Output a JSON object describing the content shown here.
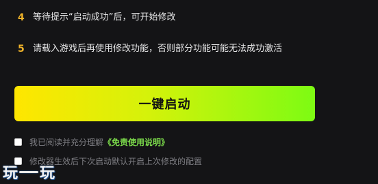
{
  "steps": [
    {
      "number": "4",
      "text": "等待提示“启动成功”后，可开始修改"
    },
    {
      "number": "5",
      "text": "请载入游戏后再使用修改功能，否则部分功能可能无法成功激活"
    }
  ],
  "launch_button": {
    "label": "一键启动"
  },
  "checkboxes": [
    {
      "text": "我已阅读并充分理解",
      "link": "《免责使用说明》"
    },
    {
      "text": "修改器生效后下次启动默认开启上次修改的配置"
    }
  ],
  "watermark": {
    "left": "玩",
    "right": "玩"
  },
  "colors": {
    "background": "#141416",
    "step_number": "#f0b32a",
    "button_gradient_start": "#ffe600",
    "button_gradient_end": "#7dfb13",
    "link": "#7ad84a"
  }
}
